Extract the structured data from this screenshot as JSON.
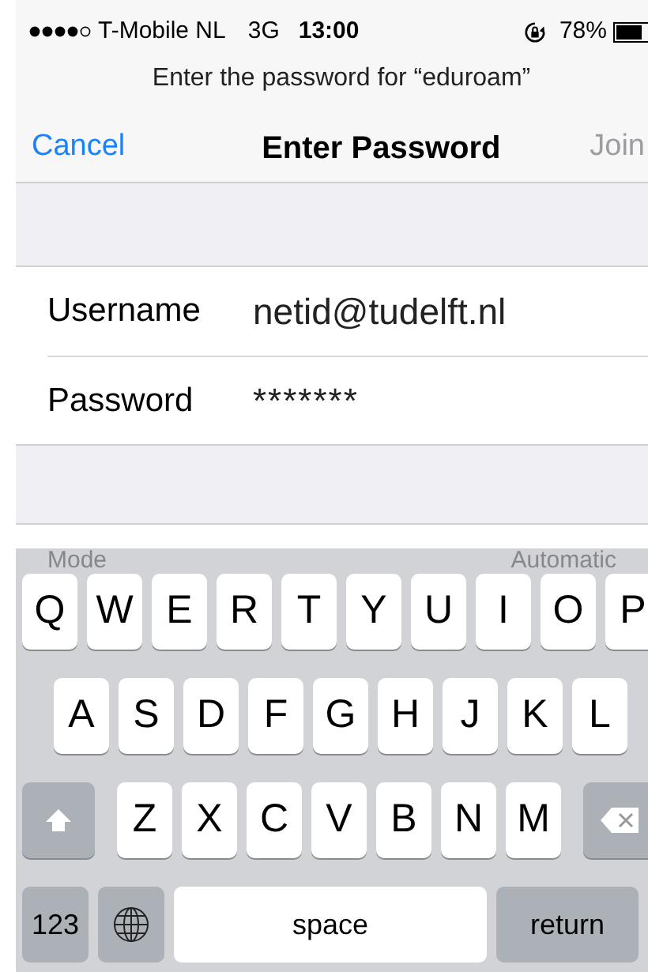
{
  "status_bar": {
    "carrier": "T-Mobile NL",
    "network": "3G",
    "time": "13:00",
    "battery": "78%"
  },
  "prompt": "Enter the password for “eduroam”",
  "nav": {
    "cancel": "Cancel",
    "title": "Enter Password",
    "join": {
      "label": "Join",
      "disabled": true
    }
  },
  "fields": [
    {
      "label": "Username",
      "value": "netid@tudelft.nl",
      "kind": "text"
    },
    {
      "label": "Password",
      "value": "*******",
      "kind": "secret"
    }
  ],
  "mode_row": {
    "label": "Mode",
    "value": "Automatic"
  },
  "keyboard": {
    "rows": [
      [
        "Q",
        "W",
        "E",
        "R",
        "T",
        "Y",
        "U",
        "I",
        "O",
        "P"
      ],
      [
        "A",
        "S",
        "D",
        "F",
        "G",
        "H",
        "J",
        "K",
        "L"
      ],
      [
        "Z",
        "X",
        "C",
        "V",
        "B",
        "N",
        "M"
      ]
    ],
    "numbers": "123",
    "space": "space",
    "return": "return"
  }
}
